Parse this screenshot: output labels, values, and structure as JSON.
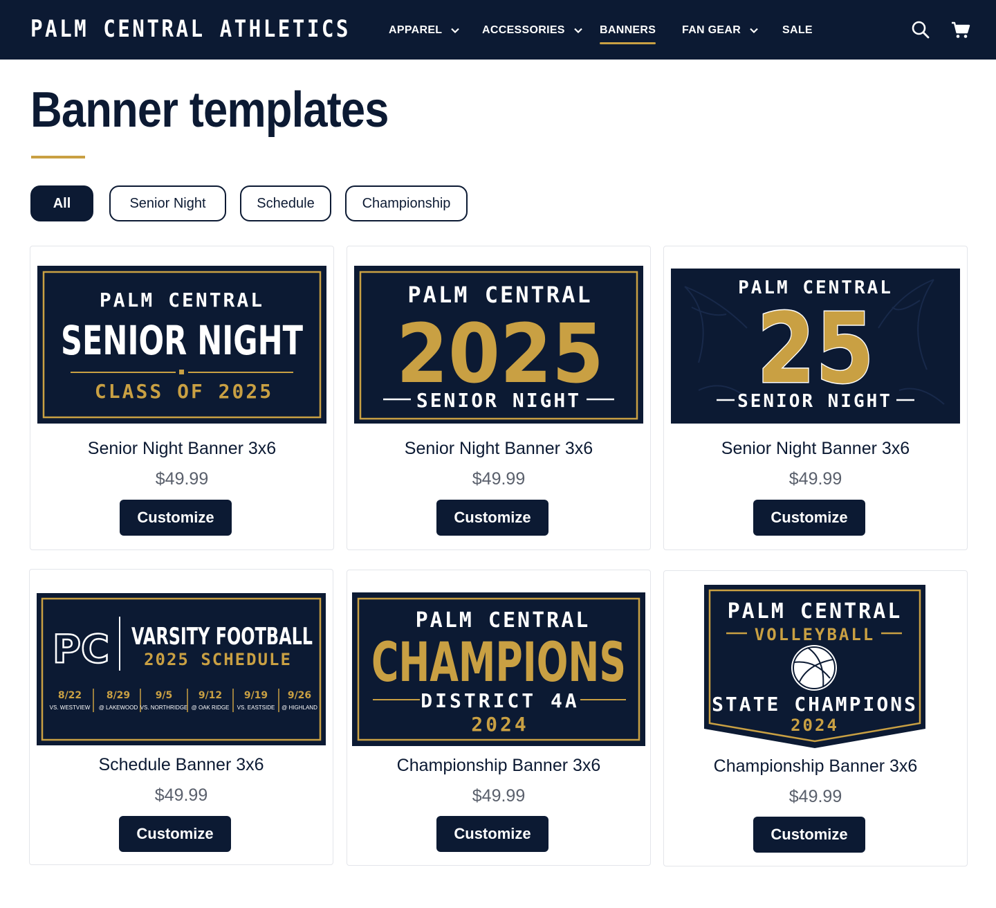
{
  "brand": "PALM CENTRAL ATHLETICS",
  "nav": [
    {
      "label": "APPAREL",
      "has_dropdown": true,
      "active": false
    },
    {
      "label": "ACCESSORIES",
      "has_dropdown": true,
      "active": false
    },
    {
      "label": "BANNERS",
      "has_dropdown": false,
      "active": true
    },
    {
      "label": "FAN GEAR",
      "has_dropdown": true,
      "active": false
    },
    {
      "label": "SALE",
      "has_dropdown": false,
      "active": false
    }
  ],
  "header_icons": [
    "search-icon",
    "cart-icon"
  ],
  "page_title": "Banner templates",
  "filters": [
    {
      "label": "All",
      "active": true
    },
    {
      "label": "Senior Night",
      "active": false
    },
    {
      "label": "Schedule",
      "active": false
    },
    {
      "label": "Championship",
      "active": false
    }
  ],
  "colors": {
    "navy": "#0c1a33",
    "gold": "#c9a043",
    "white": "#ffffff",
    "price_gray": "#5a606c"
  },
  "products": [
    {
      "name": "Senior Night Banner 3x6",
      "price": "$49.99",
      "button": "Customize",
      "banner": {
        "line1": "PALM CENTRAL",
        "line2": "SENIOR NIGHT",
        "line3": "CLASS OF 2025"
      }
    },
    {
      "name": "Senior Night Banner 3x6",
      "price": "$49.99",
      "button": "Customize",
      "banner": {
        "line1": "PALM CENTRAL",
        "line2": "2025",
        "line3": "SENIOR NIGHT"
      }
    },
    {
      "name": "Senior Night Banner 3x6",
      "price": "$49.99",
      "button": "Customize",
      "banner": {
        "line1": "PALM CENTRAL",
        "line2": "25",
        "line3": "SENIOR NIGHT"
      }
    },
    {
      "name": "Schedule Banner 3x6",
      "price": "$49.99",
      "button": "Customize",
      "banner": {
        "logo": "PC",
        "line1": "VARSITY FOOTBALL",
        "line2": "2025 SCHEDULE",
        "games": [
          {
            "date": "8/22",
            "opponent": "VS. WESTVIEW"
          },
          {
            "date": "8/29",
            "opponent": "@ LAKEWOOD"
          },
          {
            "date": "9/5",
            "opponent": "VS. NORTHRIDGE"
          },
          {
            "date": "9/12",
            "opponent": "@ OAK RIDGE"
          },
          {
            "date": "9/19",
            "opponent": "VS. EASTSIDE"
          },
          {
            "date": "9/26",
            "opponent": "@ HIGHLAND"
          }
        ]
      }
    },
    {
      "name": "Championship Banner 3x6",
      "price": "$49.99",
      "button": "Customize",
      "banner": {
        "line1": "PALM CENTRAL",
        "line2": "CHAMPIONS",
        "line3": "DISTRICT 4A",
        "line4": "2024"
      }
    },
    {
      "name": "Championship Banner 3x6",
      "price": "$49.99",
      "button": "Customize",
      "banner": {
        "line1": "PALM CENTRAL",
        "line2": "VOLLEYBALL",
        "line3": "STATE CHAMPIONS",
        "line4": "2024"
      }
    }
  ]
}
